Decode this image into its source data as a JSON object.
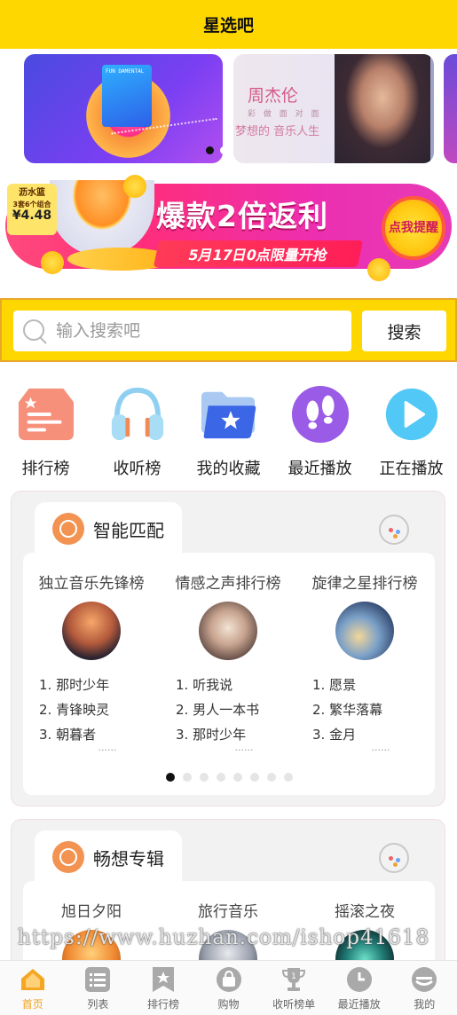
{
  "app": {
    "title": "星选吧"
  },
  "banner": {
    "slide1": {
      "card_text": "FUN DAMENTAL"
    },
    "slide2": {
      "title": "周杰伦",
      "subtitle": "彩 做 面 对 面",
      "caption": "梦想的 音乐人生"
    }
  },
  "promo": {
    "tag_brand": "沥水篮",
    "tag_sub": "3套6个组合",
    "tag_price": "¥4.48",
    "headline": "爆款2倍返利",
    "ribbon": "5月17日0点限量开抢",
    "cta": "点我提醒"
  },
  "search": {
    "placeholder": "输入搜索吧",
    "button": "搜索"
  },
  "quick_nav": [
    {
      "label": "排行榜",
      "icon": "ranking-icon"
    },
    {
      "label": "收听榜",
      "icon": "headphones-icon"
    },
    {
      "label": "我的收藏",
      "icon": "favorites-folder-icon"
    },
    {
      "label": "最近播放",
      "icon": "footprints-icon"
    },
    {
      "label": "正在播放",
      "icon": "play-icon"
    }
  ],
  "section_smart": {
    "title": "智能匹配",
    "columns": [
      {
        "name": "独立音乐先锋榜",
        "items": [
          "1. 那时少年",
          "2. 青锋映灵",
          "3. 朝暮者"
        ],
        "more": "......"
      },
      {
        "name": "情感之声排行榜",
        "items": [
          "1. 听我说",
          "2. 男人一本书",
          "3. 那时少年"
        ],
        "more": "......"
      },
      {
        "name": "旋律之星排行榜",
        "items": [
          "1. 愿景",
          "2. 繁华落幕",
          "3. 金月"
        ],
        "more": "......"
      }
    ],
    "pager_count": 8,
    "pager_active": 0
  },
  "section_album": {
    "title": "畅想专辑",
    "columns": [
      {
        "name": "旭日夕阳"
      },
      {
        "name": "旅行音乐"
      },
      {
        "name": "摇滚之夜"
      }
    ]
  },
  "watermark": "https://www.huzhan.com/ishop41618",
  "tabbar": [
    {
      "label": "首页",
      "icon": "home-icon",
      "active": true
    },
    {
      "label": "列表",
      "icon": "list-icon"
    },
    {
      "label": "排行榜",
      "icon": "bookmark-star-icon"
    },
    {
      "label": "购物",
      "icon": "shopping-bag-icon"
    },
    {
      "label": "收听榜单",
      "icon": "trophy-icon"
    },
    {
      "label": "最近播放",
      "icon": "clock-icon"
    },
    {
      "label": "我的",
      "icon": "user-icon"
    }
  ]
}
